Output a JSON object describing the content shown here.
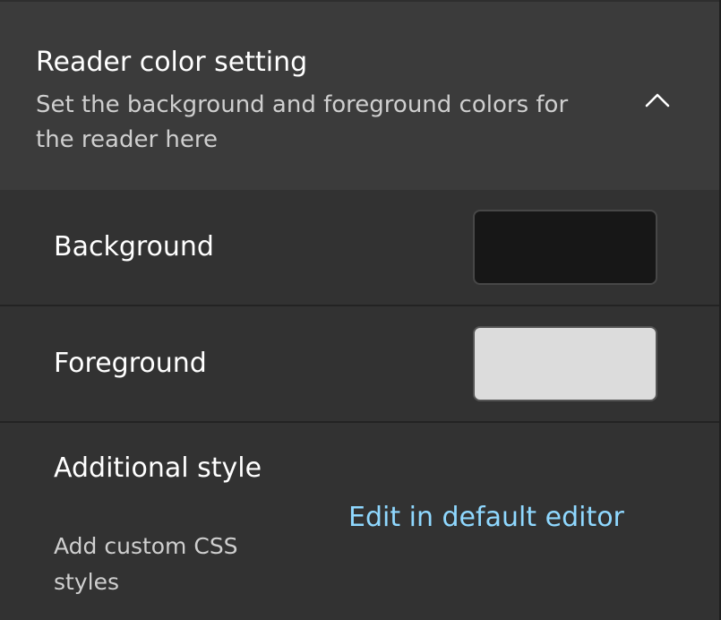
{
  "section": {
    "title": "Reader color setting",
    "description": "Set the background and foreground colors for the reader here",
    "expand_icon": "chevron-up-icon"
  },
  "background": {
    "label": "Background",
    "color": "#171717"
  },
  "foreground": {
    "label": "Foreground",
    "color": "#dcdcdc"
  },
  "additional_style": {
    "title": "Additional style",
    "description": "Add custom CSS styles",
    "link_label": "Edit in default editor",
    "link_color": "#8fd8ff"
  }
}
